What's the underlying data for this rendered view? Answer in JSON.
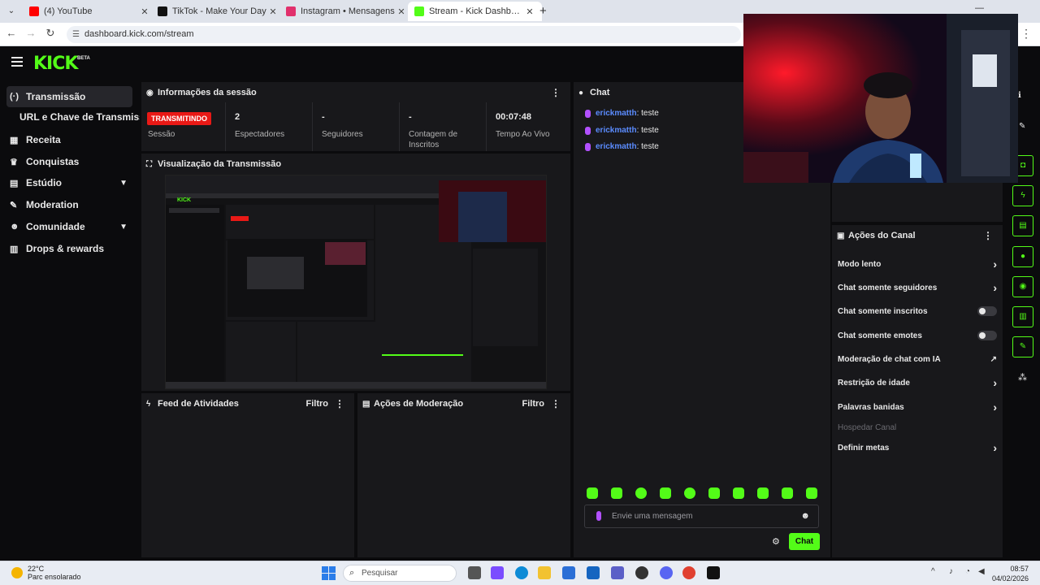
{
  "browser": {
    "tabs": [
      {
        "title": "(4) YouTube",
        "color": "#ff0000",
        "active": false
      },
      {
        "title": "TikTok - Make Your Day",
        "color": "#111111",
        "active": false
      },
      {
        "title": "Instagram • Mensagens",
        "color": "#e1306c",
        "active": false
      },
      {
        "title": "Stream - Kick Dashboard",
        "color": "#53fc18",
        "active": true
      }
    ],
    "url": "dashboard.kick.com/stream"
  },
  "kick": {
    "logo": "KICK",
    "beta": "BETA"
  },
  "sidebar": {
    "items": [
      {
        "label": "Transmissão",
        "icon": "broadcast-icon"
      },
      {
        "label": "Receita",
        "icon": "revenue-icon"
      },
      {
        "label": "Conquistas",
        "icon": "trophy-icon"
      },
      {
        "label": "Estúdio",
        "icon": "studio-icon"
      },
      {
        "label": "Moderation",
        "icon": "wrench-icon"
      },
      {
        "label": "Comunidade",
        "icon": "community-icon"
      },
      {
        "label": "Drops & rewards",
        "icon": "drops-icon"
      }
    ],
    "sub_item": "URL e Chave de Transmissão"
  },
  "session": {
    "title": "Informações da sessão",
    "live_badge": "TRANSMITINDO",
    "stats": [
      {
        "value": "",
        "label": "Sessão"
      },
      {
        "value": "2",
        "label": "Espectadores"
      },
      {
        "value": "-",
        "label": "Seguidores"
      },
      {
        "value": "-",
        "label": "Contagem de Inscritos"
      },
      {
        "value": "00:07:48",
        "label": "Tempo Ao Vivo"
      }
    ]
  },
  "preview": {
    "title": "Visualização da Transmissão"
  },
  "activity": {
    "title": "Feed de Atividades",
    "filter": "Filtro"
  },
  "moderation": {
    "title": "Ações de Moderação",
    "filter": "Filtro"
  },
  "chat": {
    "title": "Chat",
    "messages": [
      {
        "user": "erickmatth",
        "text": ": teste"
      },
      {
        "user": "erickmatth",
        "text": ": teste"
      },
      {
        "user": "erickmatth",
        "text": ": teste"
      }
    ],
    "placeholder": "Envie uma mensagem",
    "send_label": "Chat"
  },
  "channel_actions": {
    "title": "Ações do Canal",
    "rows": [
      {
        "label": "Modo lento",
        "control": "chevron"
      },
      {
        "label": "Chat somente seguidores",
        "control": "chevron"
      },
      {
        "label": "Chat somente inscritos",
        "control": "toggle"
      },
      {
        "label": "Chat somente emotes",
        "control": "toggle"
      },
      {
        "label": "Moderação de chat com IA",
        "control": "external"
      },
      {
        "label": "Restrição de idade",
        "control": "chevron"
      },
      {
        "label": "Palavras banidas",
        "control": "chevron"
      },
      {
        "label": "Hospedar Canal",
        "control": "none"
      },
      {
        "label": "Definir metas",
        "control": "chevron"
      }
    ]
  },
  "taskbar": {
    "temp": "22°C",
    "weather": "Parc ensolarado",
    "search": "Pesquisar",
    "time": "08:57",
    "date": "04/02/2026"
  },
  "colors": {
    "accent": "#53fc18",
    "live": "#e91916",
    "panel": "#18181b"
  }
}
